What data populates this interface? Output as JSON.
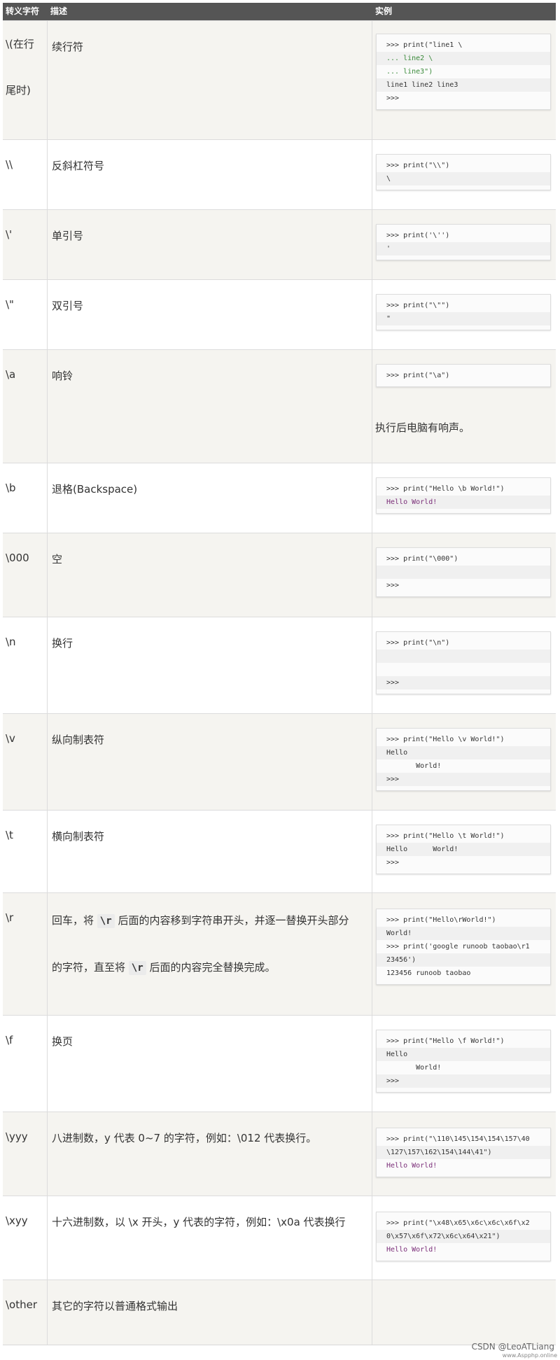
{
  "header": {
    "col1": "转义字符",
    "col2": "描述",
    "col3": "实例"
  },
  "rows": [
    {
      "esc": "\\(在行尾时)",
      "desc": "续行符",
      "code": [
        ">>> print(\"line1 \\",
        "... line2 \\",
        "... line3\")",
        "line1 line2 line3",
        ">>>"
      ]
    },
    {
      "esc": "\\\\",
      "desc": "反斜杠符号",
      "code": [
        ">>> print(\"\\\\\")",
        "\\"
      ]
    },
    {
      "esc": "\\'",
      "desc": "单引号",
      "code": [
        ">>> print('\\'')",
        "'"
      ]
    },
    {
      "esc": "\\\"",
      "desc": "双引号",
      "code": [
        ">>> print(\"\\\"\")",
        "\""
      ]
    },
    {
      "esc": "\\a",
      "desc": "响铃",
      "code": [
        ">>> print(\"\\a\")"
      ],
      "note": "执行后电脑有响声。"
    },
    {
      "esc": "\\b",
      "desc": "退格(Backspace)",
      "code": [
        ">>> print(\"Hello \\b World!\")",
        "Hello World!"
      ]
    },
    {
      "esc": "\\000",
      "desc": "空",
      "code": [
        ">>> print(\"\\000\")",
        "",
        ">>>"
      ]
    },
    {
      "esc": "\\n",
      "desc": "换行",
      "code": [
        ">>> print(\"\\n\")",
        "",
        "",
        ">>>"
      ]
    },
    {
      "esc": "\\v",
      "desc": "纵向制表符",
      "code": [
        ">>> print(\"Hello \\v World!\")",
        "Hello",
        "       World!",
        ">>>"
      ]
    },
    {
      "esc": "\\t",
      "desc": "横向制表符",
      "code": [
        ">>> print(\"Hello \\t World!\")",
        "Hello      World!",
        ">>>"
      ]
    },
    {
      "esc": "\\r",
      "desc_a": "回车，将",
      "desc_code": "\\r",
      "desc_b": "后面的内容移到字符串开头，并逐一替换开头部分",
      "desc_c": "的字符，直至将",
      "desc_d": "后面的内容完全替换完成。",
      "code": [
        ">>> print(\"Hello\\rWorld!\")",
        "World!",
        ">>> print('google runoob taobao\\r1",
        "23456')",
        "123456 runoob taobao"
      ]
    },
    {
      "esc": "\\f",
      "desc": "换页",
      "code": [
        ">>> print(\"Hello \\f World!\")",
        "Hello",
        "       World!",
        ">>>"
      ]
    },
    {
      "esc": "\\yyy",
      "desc": "八进制数，y 代表 0~7 的字符，例如：\\012 代表换行。",
      "code": [
        ">>> print(\"\\110\\145\\154\\154\\157\\40",
        "\\127\\157\\162\\154\\144\\41\")",
        "Hello World!"
      ]
    },
    {
      "esc": "\\xyy",
      "desc": "十六进制数，以 \\x 开头，y 代表的字符，例如：\\x0a 代表换行",
      "code": [
        ">>> print(\"\\x48\\x65\\x6c\\x6c\\x6f\\x2",
        "0\\x57\\x6f\\x72\\x6c\\x64\\x21\")",
        "Hello World!"
      ]
    },
    {
      "esc": "\\other",
      "desc": "其它的字符以普通格式输出",
      "code": []
    }
  ],
  "watermark": "CSDN @LeoATLiang",
  "watermark_small": "www.Aspphp.online"
}
